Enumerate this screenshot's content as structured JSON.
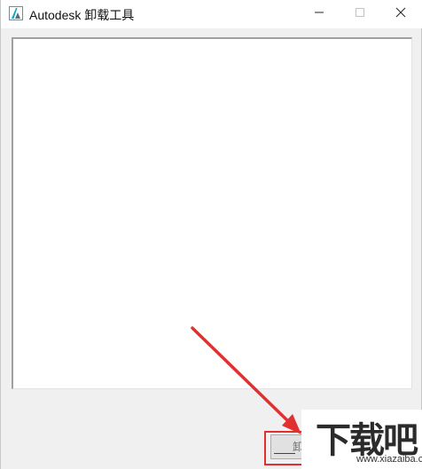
{
  "window": {
    "title": "Autodesk 卸载工具",
    "app_icon": "autodesk-logo-icon",
    "controls": [
      "minimize-icon",
      "maximize-icon",
      "close-icon"
    ]
  },
  "main": {
    "list_box_items": []
  },
  "button": {
    "label": "卸"
  },
  "annotation": {
    "color": "#e03030"
  },
  "watermark": {
    "logo_text": "下载吧",
    "url": "www.xiazaiba.com"
  }
}
